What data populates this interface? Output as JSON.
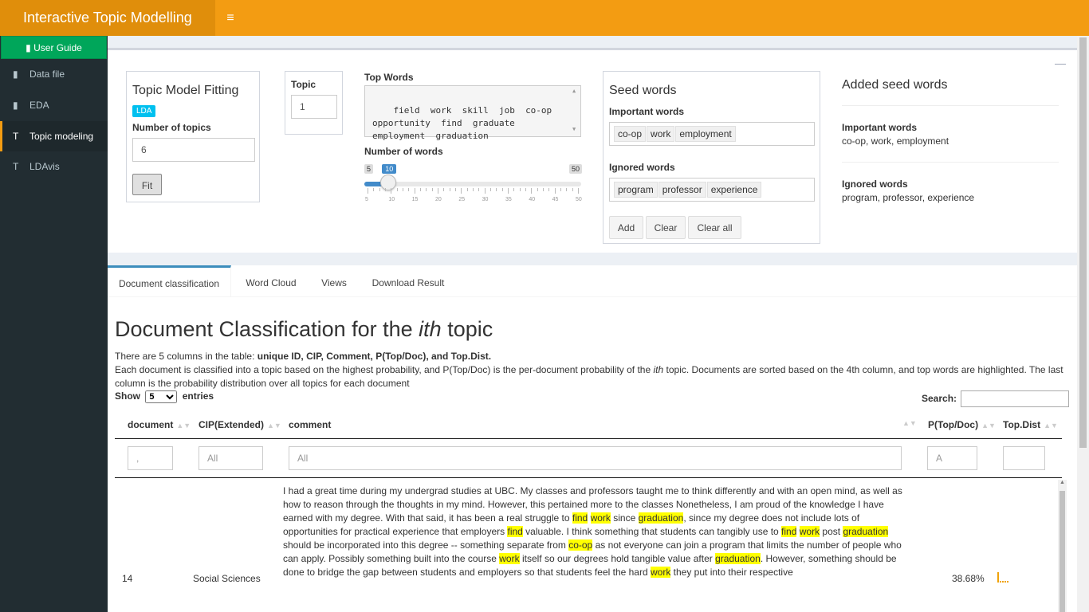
{
  "header": {
    "title": "Interactive Topic Modelling",
    "menu_icon": "≡"
  },
  "sidebar": {
    "guide": "User Guide",
    "items": [
      {
        "label": "Data file",
        "icon": "bar-chart-icon",
        "glyph": "▮"
      },
      {
        "label": "EDA",
        "icon": "bar-chart-icon",
        "glyph": "▮"
      },
      {
        "label": "Topic modeling",
        "icon": "text-icon",
        "glyph": "T"
      },
      {
        "label": "LDAvis",
        "icon": "text-icon",
        "glyph": "T"
      }
    ]
  },
  "fitting": {
    "title": "Topic Model Fitting",
    "badge": "LDA",
    "num_topics_label": "Number of topics",
    "num_topics_value": "6",
    "fit_button": "Fit"
  },
  "topic": {
    "label": "Topic",
    "value": "1"
  },
  "top_words": {
    "label": "Top Words",
    "text": "field  work  skill  job  co-op\nopportunity  find  graduate\nemployment  graduation"
  },
  "num_words": {
    "label": "Number of words",
    "min": 5,
    "max": 50,
    "value": 10,
    "min_label": "5",
    "max_label": "50",
    "value_label": "10",
    "ticks": [
      "5",
      "10",
      "15",
      "20",
      "25",
      "30",
      "35",
      "40",
      "45",
      "50"
    ]
  },
  "seed": {
    "title": "Seed words",
    "important_label": "Important words",
    "important": [
      "co-op",
      "work",
      "employment"
    ],
    "ignored_label": "Ignored words",
    "ignored": [
      "program",
      "professor",
      "experience"
    ],
    "add_button": "Add",
    "clear_button": "Clear",
    "clear_all_button": "Clear all"
  },
  "added": {
    "title": "Added seed words",
    "important_label": "Important words",
    "important_text": "co-op, work, employment",
    "ignored_label": "Ignored words",
    "ignored_text": "program, professor, experience"
  },
  "tabs": [
    "Document classification",
    "Word Cloud",
    "Views",
    "Download Result"
  ],
  "doc": {
    "title_pre": "Document Classification for the ",
    "title_em": "ith",
    "title_post": " topic",
    "desc1_pre": "There are 5 columns in the table: ",
    "desc1_bold": "unique ID, CIP, Comment, P(Top/Doc), and Top.Dist.",
    "desc2_pre": "Each document is classified into a topic based on the highest probability, and P(Top/Doc) is the per-document probability of the ",
    "desc2_em": "ith",
    "desc2_post": " topic. Documents are sorted based on the 4th column, and top words are highlighted. The last column is the probability distribution over all topics for each document",
    "show_label": "Show",
    "show_value": "5",
    "entries_label": "entries",
    "search_label": "Search:"
  },
  "table": {
    "headers": [
      "document",
      "CIP(Extended)",
      "comment",
      "P(Top/Doc)",
      "Top.Dist"
    ],
    "filters": [
      ",",
      "All",
      "All",
      "A",
      ""
    ],
    "row": {
      "document": "14",
      "cip": "Social Sciences",
      "p": "38.68%",
      "comment_html": "I had a great time during my undergrad studies at UBC. My classes and professors taught me to think differently and with an open mind, as well as how to reason through the thoughts in my mind. However, this pertained more to the classes Nonetheless, I am proud of the knowledge I have earned with my degree. With that said, it has been a real struggle to <span class=\"hl\">find</span> <span class=\"hl\">work</span> since <span class=\"hl\">graduation</span>, since my degree does not include lots of opportunities for practical experience that employers <span class=\"hl\">find</span> valuable. I think something that students can tangibly use to <span class=\"hl\">find</span> <span class=\"hl\">work</span> post <span class=\"hl\">graduation</span> should be incorporated into this degree -- something separate from <span class=\"hl\">co-op</span> as not everyone can join a program that limits the number of people who can apply. Possibly something built into the course <span class=\"hl\">work</span> itself so our degrees hold tangible value after <span class=\"hl\">graduation</span>. However, something should be done to bridge the gap between students and employers so that students feel the hard <span class=\"hl\">work</span> they put into their respective"
    }
  }
}
